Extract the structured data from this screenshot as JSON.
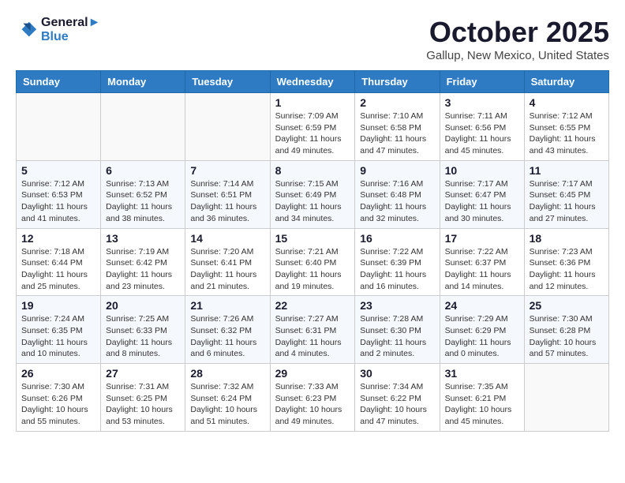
{
  "header": {
    "logo_line1": "General",
    "logo_line2": "Blue",
    "month": "October 2025",
    "location": "Gallup, New Mexico, United States"
  },
  "weekdays": [
    "Sunday",
    "Monday",
    "Tuesday",
    "Wednesday",
    "Thursday",
    "Friday",
    "Saturday"
  ],
  "weeks": [
    [
      {
        "day": "",
        "info": ""
      },
      {
        "day": "",
        "info": ""
      },
      {
        "day": "",
        "info": ""
      },
      {
        "day": "1",
        "info": "Sunrise: 7:09 AM\nSunset: 6:59 PM\nDaylight: 11 hours and 49 minutes."
      },
      {
        "day": "2",
        "info": "Sunrise: 7:10 AM\nSunset: 6:58 PM\nDaylight: 11 hours and 47 minutes."
      },
      {
        "day": "3",
        "info": "Sunrise: 7:11 AM\nSunset: 6:56 PM\nDaylight: 11 hours and 45 minutes."
      },
      {
        "day": "4",
        "info": "Sunrise: 7:12 AM\nSunset: 6:55 PM\nDaylight: 11 hours and 43 minutes."
      }
    ],
    [
      {
        "day": "5",
        "info": "Sunrise: 7:12 AM\nSunset: 6:53 PM\nDaylight: 11 hours and 41 minutes."
      },
      {
        "day": "6",
        "info": "Sunrise: 7:13 AM\nSunset: 6:52 PM\nDaylight: 11 hours and 38 minutes."
      },
      {
        "day": "7",
        "info": "Sunrise: 7:14 AM\nSunset: 6:51 PM\nDaylight: 11 hours and 36 minutes."
      },
      {
        "day": "8",
        "info": "Sunrise: 7:15 AM\nSunset: 6:49 PM\nDaylight: 11 hours and 34 minutes."
      },
      {
        "day": "9",
        "info": "Sunrise: 7:16 AM\nSunset: 6:48 PM\nDaylight: 11 hours and 32 minutes."
      },
      {
        "day": "10",
        "info": "Sunrise: 7:17 AM\nSunset: 6:47 PM\nDaylight: 11 hours and 30 minutes."
      },
      {
        "day": "11",
        "info": "Sunrise: 7:17 AM\nSunset: 6:45 PM\nDaylight: 11 hours and 27 minutes."
      }
    ],
    [
      {
        "day": "12",
        "info": "Sunrise: 7:18 AM\nSunset: 6:44 PM\nDaylight: 11 hours and 25 minutes."
      },
      {
        "day": "13",
        "info": "Sunrise: 7:19 AM\nSunset: 6:42 PM\nDaylight: 11 hours and 23 minutes."
      },
      {
        "day": "14",
        "info": "Sunrise: 7:20 AM\nSunset: 6:41 PM\nDaylight: 11 hours and 21 minutes."
      },
      {
        "day": "15",
        "info": "Sunrise: 7:21 AM\nSunset: 6:40 PM\nDaylight: 11 hours and 19 minutes."
      },
      {
        "day": "16",
        "info": "Sunrise: 7:22 AM\nSunset: 6:39 PM\nDaylight: 11 hours and 16 minutes."
      },
      {
        "day": "17",
        "info": "Sunrise: 7:22 AM\nSunset: 6:37 PM\nDaylight: 11 hours and 14 minutes."
      },
      {
        "day": "18",
        "info": "Sunrise: 7:23 AM\nSunset: 6:36 PM\nDaylight: 11 hours and 12 minutes."
      }
    ],
    [
      {
        "day": "19",
        "info": "Sunrise: 7:24 AM\nSunset: 6:35 PM\nDaylight: 11 hours and 10 minutes."
      },
      {
        "day": "20",
        "info": "Sunrise: 7:25 AM\nSunset: 6:33 PM\nDaylight: 11 hours and 8 minutes."
      },
      {
        "day": "21",
        "info": "Sunrise: 7:26 AM\nSunset: 6:32 PM\nDaylight: 11 hours and 6 minutes."
      },
      {
        "day": "22",
        "info": "Sunrise: 7:27 AM\nSunset: 6:31 PM\nDaylight: 11 hours and 4 minutes."
      },
      {
        "day": "23",
        "info": "Sunrise: 7:28 AM\nSunset: 6:30 PM\nDaylight: 11 hours and 2 minutes."
      },
      {
        "day": "24",
        "info": "Sunrise: 7:29 AM\nSunset: 6:29 PM\nDaylight: 11 hours and 0 minutes."
      },
      {
        "day": "25",
        "info": "Sunrise: 7:30 AM\nSunset: 6:28 PM\nDaylight: 10 hours and 57 minutes."
      }
    ],
    [
      {
        "day": "26",
        "info": "Sunrise: 7:30 AM\nSunset: 6:26 PM\nDaylight: 10 hours and 55 minutes."
      },
      {
        "day": "27",
        "info": "Sunrise: 7:31 AM\nSunset: 6:25 PM\nDaylight: 10 hours and 53 minutes."
      },
      {
        "day": "28",
        "info": "Sunrise: 7:32 AM\nSunset: 6:24 PM\nDaylight: 10 hours and 51 minutes."
      },
      {
        "day": "29",
        "info": "Sunrise: 7:33 AM\nSunset: 6:23 PM\nDaylight: 10 hours and 49 minutes."
      },
      {
        "day": "30",
        "info": "Sunrise: 7:34 AM\nSunset: 6:22 PM\nDaylight: 10 hours and 47 minutes."
      },
      {
        "day": "31",
        "info": "Sunrise: 7:35 AM\nSunset: 6:21 PM\nDaylight: 10 hours and 45 minutes."
      },
      {
        "day": "",
        "info": ""
      }
    ]
  ]
}
